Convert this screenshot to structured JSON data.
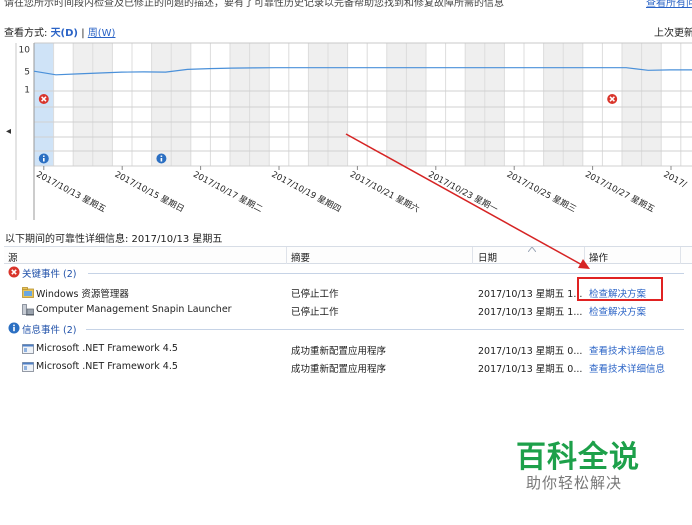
{
  "top_strip": {
    "text": "请在您所示时间段内检查及已修正的问题的描述，要有了可靠性历史记录以完备帮助您找到和修复故障所需的信息",
    "link": "查看所有问题报告"
  },
  "view_mode": {
    "label": "查看方式:",
    "day": "天(D)",
    "separator": "|",
    "week": "周(W)"
  },
  "last_check_label": "上次更新",
  "chart": {
    "y_ticks": [
      "10",
      "5",
      "1"
    ],
    "scroll_left_glyph": "◂",
    "dates": [
      "2017/10/13 星期五",
      "2017/10/15 星期日",
      "2017/10/17 星期二",
      "2017/10/19 星期四",
      "2017/10/21 星期六",
      "2017/10/23 星期一",
      "2017/10/25 星期三",
      "2017/10/27 星期五",
      "2017/"
    ]
  },
  "chart_data": {
    "type": "line",
    "ylim": [
      1,
      10
    ],
    "series": [
      {
        "values": [
          5.0,
          4.2,
          4.4,
          4.6,
          4.8,
          4.85,
          4.8,
          5.4,
          5.6,
          5.7,
          5.75,
          5.8,
          5.8,
          5.8,
          5.8,
          5.8,
          5.8,
          5.8,
          5.8,
          5.8,
          5.8,
          5.8,
          5.8,
          5.8,
          5.8,
          5.8,
          5.8,
          5.8,
          5.2,
          5.3,
          5.3
        ]
      }
    ],
    "event_rows": {
      "critical_days": [
        0,
        29
      ],
      "info_days": [
        0,
        6
      ]
    }
  },
  "detail_title": "以下期间的可靠性详细信息: 2017/10/13 星期五",
  "columns": {
    "source": "源",
    "summary": "摘要",
    "date": "日期",
    "action": "操作"
  },
  "groups": {
    "critical": "关键事件 (2)",
    "info": "信息事件 (2)"
  },
  "rows": [
    {
      "source": "Windows 资源管理器",
      "summary": "已停止工作",
      "date": "2017/10/13 星期五 1...",
      "action": "检查解决方案"
    },
    {
      "source": "Computer Management Snapin Launcher",
      "summary": "已停止工作",
      "date": "2017/10/13 星期五 1...",
      "action": "检查解决方案"
    },
    {
      "source": "Microsoft .NET Framework 4.5",
      "summary": "成功重新配置应用程序",
      "date": "2017/10/13 星期五 0...",
      "action": "查看技术详细信息"
    },
    {
      "source": "Microsoft .NET Framework 4.5",
      "summary": "成功重新配置应用程序",
      "date": "2017/10/13 星期五 0...",
      "action": "查看技术详细信息"
    }
  ],
  "watermark": {
    "main": "百科全说",
    "sub": "助你轻松解决"
  },
  "colors": {
    "link": "#2a63c6",
    "callout": "#e02222",
    "stability_line": "#4a90d9",
    "selected_column": "#cfe3f7",
    "critical_icon": "#d9352b",
    "info_icon": "#2b6fc2",
    "watermark_green": "#1da04a"
  }
}
